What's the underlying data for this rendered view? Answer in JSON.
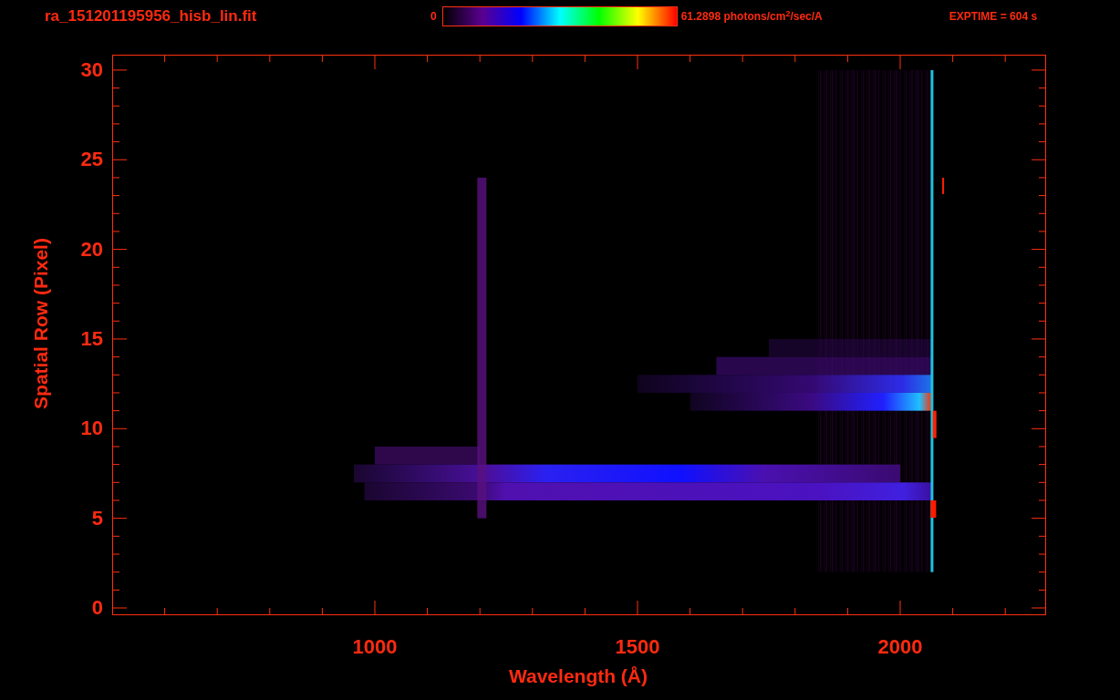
{
  "header": {
    "file_title": "ra_151201195956_hisb_lin.fit",
    "colorbar": {
      "min_label": "0",
      "max_label": "61.2898 photons/cm$^{2}$/sec/A"
    },
    "exposure": "EXPTIME = 604 s"
  },
  "plot": {
    "ylabel": "Spatial Row (Pixel)",
    "yticks": [
      "30",
      "25",
      "20",
      "15",
      "10",
      "5",
      "0"
    ],
    "xlabel": "Wavelength (Å)",
    "xticks": [
      "1000",
      "1500",
      "2000"
    ]
  }
}
